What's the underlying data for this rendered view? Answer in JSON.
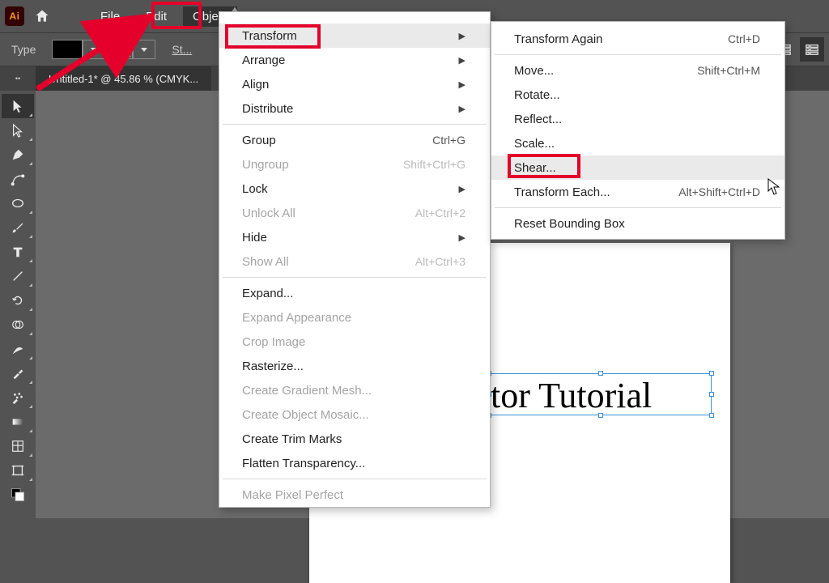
{
  "app": {
    "logo": "Ai"
  },
  "menubar": {
    "file": "File",
    "edit": "Edit",
    "object": "Object"
  },
  "ctrlbar": {
    "type": "Type",
    "stroke_label": "St..."
  },
  "tab": {
    "title": "Untitled-1* @ 45.86 % (CMYK..."
  },
  "object_menu": {
    "transform": "Transform",
    "arrange": "Arrange",
    "align": "Align",
    "distribute": "Distribute",
    "group": "Group",
    "group_sc": "Ctrl+G",
    "ungroup": "Ungroup",
    "ungroup_sc": "Shift+Ctrl+G",
    "lock": "Lock",
    "unlock": "Unlock All",
    "unlock_sc": "Alt+Ctrl+2",
    "hide": "Hide",
    "showall": "Show All",
    "showall_sc": "Alt+Ctrl+3",
    "expand": "Expand...",
    "expand_app": "Expand Appearance",
    "crop": "Crop Image",
    "rasterize": "Rasterize...",
    "grad_mesh": "Create Gradient Mesh...",
    "obj_mosaic": "Create Object Mosaic...",
    "trim": "Create Trim Marks",
    "flatten": "Flatten Transparency...",
    "pixel_perfect": "Make Pixel Perfect"
  },
  "transform_menu": {
    "again": "Transform Again",
    "again_sc": "Ctrl+D",
    "move": "Move...",
    "move_sc": "Shift+Ctrl+M",
    "rotate": "Rotate...",
    "reflect": "Reflect...",
    "scale": "Scale...",
    "shear": "Shear...",
    "each": "Transform Each...",
    "each_sc": "Alt+Shift+Ctrl+D",
    "reset": "Reset Bounding Box"
  },
  "canvas": {
    "text": "tor Tutorial"
  }
}
